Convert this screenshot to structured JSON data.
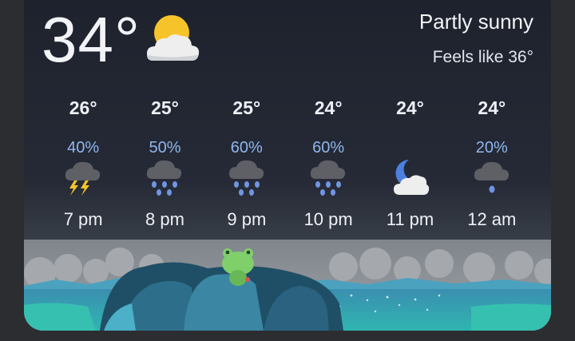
{
  "current": {
    "temperature": "34°",
    "condition": "Partly sunny",
    "feels_like": "Feels like 36°",
    "icon": "partly-sunny-icon"
  },
  "hourly": [
    {
      "temp": "26°",
      "pop": "40%",
      "time": "7 pm",
      "icon": "thunderstorm-icon"
    },
    {
      "temp": "25°",
      "pop": "50%",
      "time": "8 pm",
      "icon": "heavy-rain-icon"
    },
    {
      "temp": "25°",
      "pop": "60%",
      "time": "9 pm",
      "icon": "heavy-rain-icon"
    },
    {
      "temp": "24°",
      "pop": "60%",
      "time": "10 pm",
      "icon": "heavy-rain-icon"
    },
    {
      "temp": "24°",
      "pop": "",
      "time": "11 pm",
      "icon": "partly-cloudy-night-icon"
    },
    {
      "temp": "24°",
      "pop": "20%",
      "time": "12 am",
      "icon": "light-rain-icon"
    }
  ],
  "colors": {
    "precip": "#8fb6ee",
    "sun": "#f6c42a",
    "moon": "#4d7fe0",
    "frog": "#7fcf6a"
  }
}
